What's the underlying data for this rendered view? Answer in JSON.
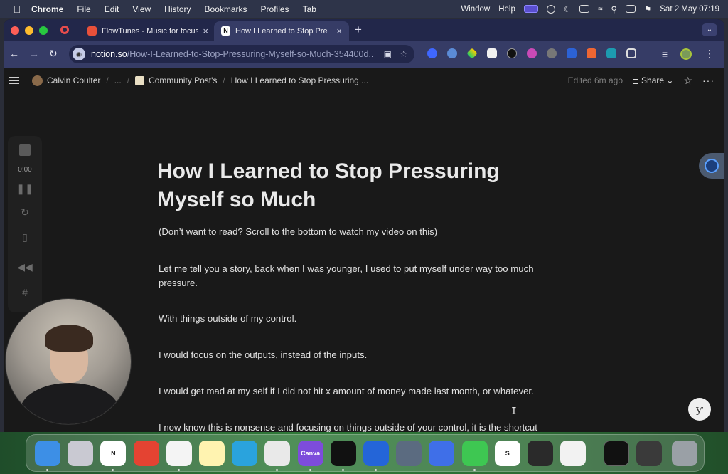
{
  "menubar": {
    "app_name": "Chrome",
    "items": [
      "File",
      "Edit",
      "View",
      "History",
      "Bookmarks",
      "Profiles",
      "Tab"
    ],
    "window_label": "Window",
    "help_label": "Help",
    "datetime": "Sat 2 May  07:19"
  },
  "browser": {
    "tabs": [
      {
        "title": "FlowTunes - Music for focus",
        "favicon_color": "#e8503a"
      },
      {
        "title": "How I Learned to Stop Pre",
        "favicon_color": "#ffffff"
      }
    ],
    "url_host": "notion.so",
    "url_path": "/How-I-Learned-to-Stop-Pressuring-Myself-so-Much-354400d..."
  },
  "notion": {
    "breadcrumbs": [
      "Calvin Coulter",
      "...",
      "Community Post's",
      "How I Learned to Stop Pressuring ..."
    ],
    "edited": "Edited 6m ago",
    "share_label": "Share",
    "title_line1": "How I Learned to Stop Pressuring",
    "title_line2": "Myself so Much",
    "paragraphs": [
      "(Don’t want to read? Scroll to the bottom to watch my video on this)",
      "Let me tell you a story, back when I was younger, I used to put myself under way too much pressure.",
      "With things outside of my control.",
      "I would focus on the outputs, instead of the inputs.",
      " I would get mad at my self if I did not hit x amount of money made last month, or whatever.",
      "I now know this is nonsense and focusing on things outside of your control, it is the shortcut to"
    ]
  },
  "recorder": {
    "time": "0:00"
  },
  "dock": {
    "apps": [
      {
        "name": "finder",
        "color": "#3d8fe6",
        "label": ""
      },
      {
        "name": "launchpad",
        "color": "#c9c9d2",
        "label": ""
      },
      {
        "name": "notion",
        "color": "#ffffff",
        "label": "N"
      },
      {
        "name": "todoist",
        "color": "#e44332",
        "label": ""
      },
      {
        "name": "reminders",
        "color": "#f4f4f4",
        "label": ""
      },
      {
        "name": "notes",
        "color": "#fff3b0",
        "label": ""
      },
      {
        "name": "telegram",
        "color": "#2aa3dd",
        "label": ""
      },
      {
        "name": "chrome",
        "color": "#e9e9e9",
        "label": ""
      },
      {
        "name": "canva",
        "color": "#7d4cdb",
        "label": "Canva"
      },
      {
        "name": "capcut",
        "color": "#111111",
        "label": ""
      },
      {
        "name": "app-blue-gear",
        "color": "#2465d8",
        "label": ""
      },
      {
        "name": "quicktime",
        "color": "#5b6b80",
        "label": ""
      },
      {
        "name": "app-blue-shield",
        "color": "#3f6fe8",
        "label": ""
      },
      {
        "name": "messages",
        "color": "#3ec752",
        "label": ""
      },
      {
        "name": "app-s",
        "color": "#ffffff",
        "label": "S"
      },
      {
        "name": "app-lotus",
        "color": "#2a2a2a",
        "label": ""
      },
      {
        "name": "photos",
        "color": "#f2f2f2",
        "label": ""
      }
    ]
  }
}
